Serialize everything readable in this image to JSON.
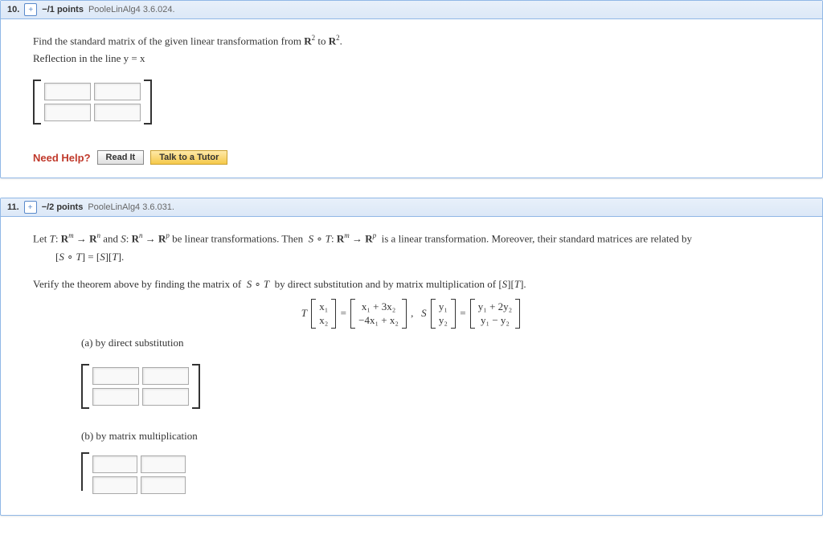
{
  "q10": {
    "number": "10.",
    "points": "−/1 points",
    "source": "PooleLinAlg4 3.6.024.",
    "prompt_html": "Find the standard matrix of the given linear transformation from <span class='bold-r'>R</span><sup>2</sup> to <span class='bold-r'>R</span><sup>2</sup>.",
    "subprompt": "Reflection in the line y = x",
    "need_help": "Need Help?",
    "read_it": "Read It",
    "tutor": "Talk to a Tutor"
  },
  "q11": {
    "number": "11.",
    "points": "−/2 points",
    "source": "PooleLinAlg4 3.6.031.",
    "theorem_html": "Let <i>T</i>: <span class='bold-r'>R</span><sup><i>m</i></sup> → <span class='bold-r'>R</span><sup><i>n</i></sup> and <i>S</i>: <span class='bold-r'>R</span><sup><i>n</i></sup> → <span class='bold-r'>R</span><sup><i>p</i></sup> be linear transformations. Then &nbsp;<i>S</i> ∘ <i>T</i>: <span class='bold-r'>R</span><sup><i>m</i></sup> → <span class='bold-r'>R</span><sup><i>p</i></sup>&nbsp; is a linear transformation. Moreover, their standard matrices are related by",
    "theorem_eq": "[S ∘ T] = [S][T].",
    "verify_html": "Verify the theorem above by finding the matrix of &nbsp;<i>S</i> ∘ <i>T</i>&nbsp; by direct substitution and by matrix multiplication of [<i>S</i>][<i>T</i>].",
    "T_vec_top": "x₁",
    "T_vec_bot": "x₂",
    "T_res_top": "x₁ + 3x₂",
    "T_res_bot": "−4x₁ + x₂",
    "S_vec_top": "y₁",
    "S_vec_bot": "y₂",
    "S_res_top": "y₁ + 2y₂",
    "S_res_bot": "y₁ − y₂",
    "part_a": "(a) by direct substitution",
    "part_b": "(b) by matrix multiplication"
  }
}
